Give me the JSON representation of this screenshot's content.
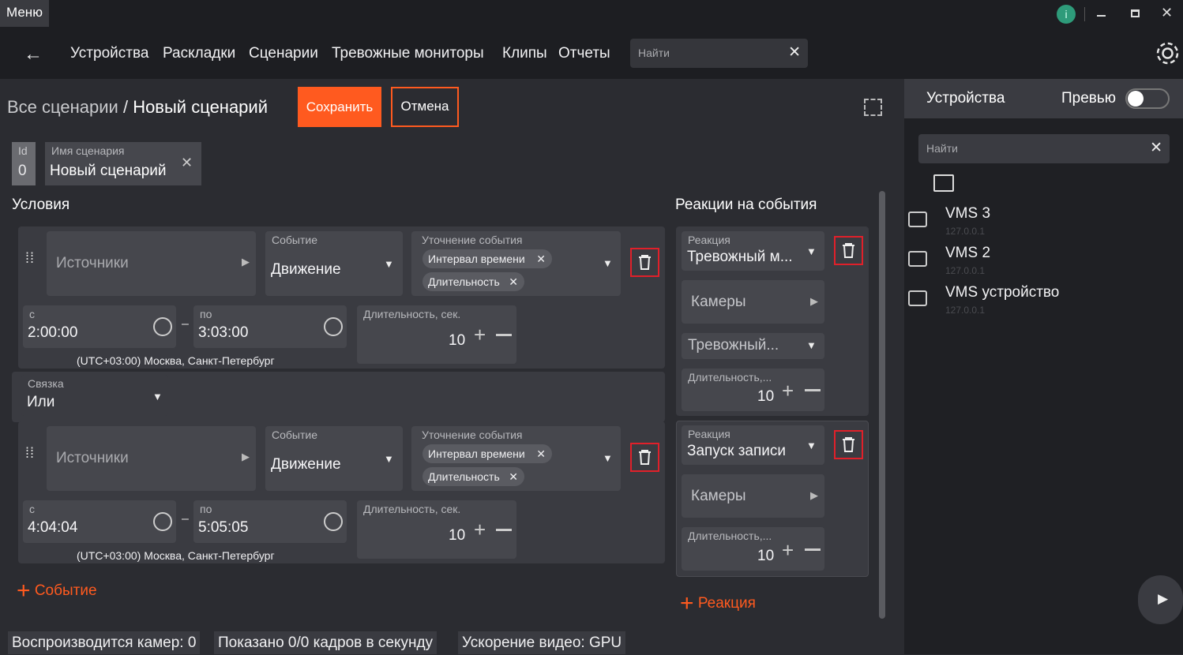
{
  "titlebar": {
    "menu": "Меню",
    "info_icon": "info-icon"
  },
  "nav": {
    "items": [
      "Устройства",
      "Раскладки",
      "Сценарии",
      "Тревожные мониторы",
      "Клипы",
      "Отчеты"
    ],
    "search_placeholder": "Найти"
  },
  "breadcrumb": {
    "root": "Все сценарии",
    "sep": "/",
    "current": "Новый сценарий"
  },
  "buttons": {
    "save": "Сохранить",
    "cancel": "Отмена"
  },
  "scenario": {
    "id_label": "Id",
    "id_value": "0",
    "name_label": "Имя сценария",
    "name_value": "Новый сценарий"
  },
  "conditions": {
    "title": "Условия",
    "items": [
      {
        "source": "Источники",
        "event_label": "Событие",
        "event_value": "Движение",
        "refine_label": "Уточнение события",
        "chips": [
          "Интервал времени",
          "Длительность"
        ],
        "from_label": "с",
        "from_value": "2:00:00",
        "to_label": "по",
        "to_value": "3:03:00",
        "dash": "–",
        "duration_label": "Длительность, сек.",
        "duration_value": "10",
        "timezone": "(UTC+03:00) Москва, Санкт-Петербург"
      },
      {
        "source": "Источники",
        "event_label": "Событие",
        "event_value": "Движение",
        "refine_label": "Уточнение события",
        "chips": [
          "Интервал времени",
          "Длительность"
        ],
        "from_label": "с",
        "from_value": "4:04:04",
        "to_label": "по",
        "to_value": "5:05:05",
        "dash": "–",
        "duration_label": "Длительность, сек.",
        "duration_value": "10",
        "timezone": "(UTC+03:00) Москва, Санкт-Петербург"
      }
    ],
    "link_label": "Связка",
    "link_value": "Или",
    "add_event": "Событие"
  },
  "reactions": {
    "title": "Реакции на события",
    "items": [
      {
        "label": "Реакция",
        "value": "Тревожный м...",
        "cameras": "Камеры",
        "extra": "Тревожный...",
        "duration_label": "Длительность,...",
        "duration_value": "10"
      },
      {
        "label": "Реакция",
        "value": "Запуск записи",
        "cameras": "Камеры",
        "duration_label": "Длительность,...",
        "duration_value": "10"
      }
    ],
    "add_reaction": "Реакция"
  },
  "status": {
    "cameras": "Воспроизводится камер: 0",
    "fps": "Показано 0/0 кадров в секунду",
    "accel": "Ускорение видео: GPU"
  },
  "right_panel": {
    "tab": "Устройства",
    "preview": "Превью",
    "search_placeholder": "Найти",
    "devices": [
      {
        "name": "VMS 3",
        "ip": "127.0.0.1"
      },
      {
        "name": "VMS 2",
        "ip": "127.0.0.1"
      },
      {
        "name": "VMS устройство",
        "ip": "127.0.0.1"
      }
    ]
  },
  "colors": {
    "accent": "#ff5a1f",
    "trash_border": "#e0202a",
    "info": "#2e9b7a"
  }
}
